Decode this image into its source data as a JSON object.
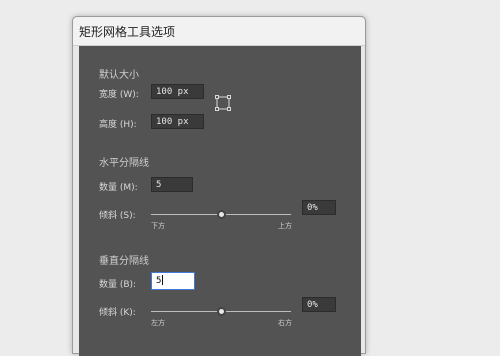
{
  "window": {
    "title": "矩形网格工具选项"
  },
  "default_size": {
    "section_title": "默认大小",
    "width_label": "宽度 (W):",
    "width_value": "100 px",
    "height_label": "高度 (H):",
    "height_value": "100 px"
  },
  "horizontal_dividers": {
    "section_title": "水平分隔线",
    "count_label": "数量 (M):",
    "count_value": "5",
    "skew_label": "倾斜 (S):",
    "skew_value": "0%",
    "left_label": "下方",
    "right_label": "上方",
    "skew_slider_level": 0.5
  },
  "vertical_dividers": {
    "section_title": "垂直分隔线",
    "count_label": "数量 (B):",
    "count_value": "5",
    "skew_label": "倾斜 (K):",
    "skew_value": "0%",
    "left_label": "左方",
    "right_label": "右方",
    "skew_slider_level": 0.5
  },
  "icons": {
    "constrain": "constrain-proportions-icon"
  }
}
